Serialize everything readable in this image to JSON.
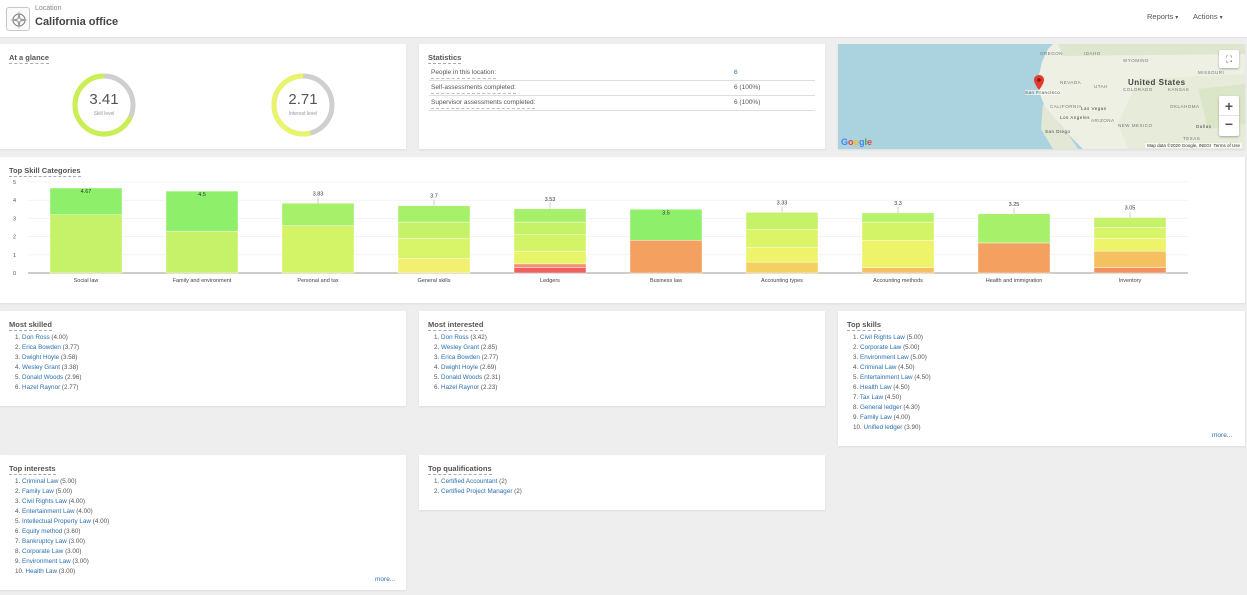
{
  "header": {
    "location_label": "Location",
    "location_name": "California office",
    "reports_label": "Reports",
    "actions_label": "Actions"
  },
  "at_a_glance": {
    "title": "At a glance",
    "gauges": [
      {
        "value": "3.41",
        "label": "Skill level",
        "fraction": 0.68,
        "color": "#c9ef54"
      },
      {
        "value": "2.71",
        "label": "Interest level",
        "fraction": 0.54,
        "color": "#e9f46a"
      }
    ]
  },
  "statistics": {
    "title": "Statistics",
    "rows": [
      {
        "label": "People in this location:",
        "value": "6"
      },
      {
        "label": "Self-assessments completed:",
        "value": "6 (100%)"
      },
      {
        "label": "Supervisor assessments completed:",
        "value": "6 (100%)"
      }
    ]
  },
  "map": {
    "labels": [
      "OREGON",
      "IDAHO",
      "WYOMING",
      "NEVADA",
      "UTAH",
      "COLORADO",
      "KANSAS",
      "CALIFORNIA",
      "ARIZONA",
      "NEW MEXICO",
      "OKLAHOMA",
      "TEXAS",
      "Las Vegas",
      "Los Angeles",
      "San Diego",
      "Dallas",
      "MISSOURI",
      "San Francisco"
    ],
    "country": "United States",
    "attribution": "Map data ©2020 Google, INEGI",
    "terms": "Terms of Use",
    "logo": "Google",
    "zoom_in": "+",
    "zoom_out": "−"
  },
  "top_skill_categories": {
    "title": "Top Skill Categories"
  },
  "chart_data": {
    "type": "bar",
    "stacked": true,
    "ylim": [
      0,
      5
    ],
    "yticks": [
      0,
      1,
      2,
      3,
      4,
      5
    ],
    "categories": [
      "Social law",
      "Family and environment",
      "Personal and tax",
      "General skills",
      "Ledgers",
      "Business law",
      "Accounting types",
      "Accounting methods",
      "Health and immigration",
      "Inventory"
    ],
    "totals": [
      4.67,
      4.5,
      3.83,
      3.7,
      3.53,
      3.5,
      3.33,
      3.3,
      3.25,
      3.05
    ],
    "total_labels": [
      "4.67",
      "4.5",
      "3.83",
      "3.7",
      "3.53",
      "3.5",
      "3.33",
      "3.3",
      "3.25",
      "3.05"
    ],
    "segments": [
      [
        {
          "v": 3.2,
          "c": "#c6f26a"
        },
        {
          "v": 1.47,
          "c": "#8ef06a"
        }
      ],
      [
        {
          "v": 2.3,
          "c": "#c6f26a"
        },
        {
          "v": 2.2,
          "c": "#8ef06a"
        }
      ],
      [
        {
          "v": 2.6,
          "c": "#d4f468"
        },
        {
          "v": 1.23,
          "c": "#a6f06a"
        }
      ],
      [
        {
          "v": 0.8,
          "c": "#f2f070"
        },
        {
          "v": 1.1,
          "c": "#d8f468"
        },
        {
          "v": 0.9,
          "c": "#c6f26a"
        },
        {
          "v": 0.9,
          "c": "#a6f06a"
        }
      ],
      [
        {
          "v": 0.3,
          "c": "#f06060"
        },
        {
          "v": 0.2,
          "c": "#f49070"
        },
        {
          "v": 0.7,
          "c": "#e8f46a"
        },
        {
          "v": 0.9,
          "c": "#d4f468"
        },
        {
          "v": 0.7,
          "c": "#c6f26a"
        },
        {
          "v": 0.73,
          "c": "#a6f06a"
        }
      ],
      [
        {
          "v": 1.8,
          "c": "#f4a060"
        },
        {
          "v": 1.7,
          "c": "#8ef06a"
        }
      ],
      [
        {
          "v": 0.6,
          "c": "#f4d060"
        },
        {
          "v": 0.8,
          "c": "#eef46a"
        },
        {
          "v": 1.0,
          "c": "#dcf468"
        },
        {
          "v": 0.93,
          "c": "#c6f26a"
        }
      ],
      [
        {
          "v": 0.3,
          "c": "#f4c060"
        },
        {
          "v": 1.5,
          "c": "#eef46a"
        },
        {
          "v": 1.0,
          "c": "#d4f468"
        },
        {
          "v": 0.5,
          "c": "#b6f26a"
        }
      ],
      [
        {
          "v": 1.65,
          "c": "#f4a060"
        },
        {
          "v": 1.6,
          "c": "#a6f06a"
        }
      ],
      [
        {
          "v": 0.3,
          "c": "#f49060"
        },
        {
          "v": 0.9,
          "c": "#f4c060"
        },
        {
          "v": 0.7,
          "c": "#eef46a"
        },
        {
          "v": 0.6,
          "c": "#d8f468"
        },
        {
          "v": 0.55,
          "c": "#c6f26a"
        }
      ]
    ]
  },
  "most_skilled": {
    "title": "Most skilled",
    "items": [
      {
        "num": "1.",
        "name": "Don Ross",
        "score": "(4.00)"
      },
      {
        "num": "2.",
        "name": "Erica Bowden",
        "score": "(3.77)"
      },
      {
        "num": "3.",
        "name": "Dwight Hoyle",
        "score": "(3.58)"
      },
      {
        "num": "4.",
        "name": "Wesley Grant",
        "score": "(3.38)"
      },
      {
        "num": "5.",
        "name": "Donald Woods",
        "score": "(2.96)"
      },
      {
        "num": "6.",
        "name": "Hazel Raynor",
        "score": "(2.77)"
      }
    ]
  },
  "most_interested": {
    "title": "Most interested",
    "items": [
      {
        "num": "1.",
        "name": "Don Ross",
        "score": "(3.42)"
      },
      {
        "num": "2.",
        "name": "Wesley Grant",
        "score": "(2.85)"
      },
      {
        "num": "3.",
        "name": "Erica Bowden",
        "score": "(2.77)"
      },
      {
        "num": "4.",
        "name": "Dwight Hoyle",
        "score": "(2.69)"
      },
      {
        "num": "5.",
        "name": "Donald Woods",
        "score": "(2.31)"
      },
      {
        "num": "6.",
        "name": "Hazel Raynor",
        "score": "(2.23)"
      }
    ]
  },
  "top_skills": {
    "title": "Top skills",
    "more": "more...",
    "items": [
      {
        "num": "1.",
        "name": "Civil Rights Law",
        "score": "(5.00)"
      },
      {
        "num": "2.",
        "name": "Corporate Law",
        "score": "(5.00)"
      },
      {
        "num": "3.",
        "name": "Environment Law",
        "score": "(5.00)"
      },
      {
        "num": "4.",
        "name": "Criminal Law",
        "score": "(4.50)"
      },
      {
        "num": "5.",
        "name": "Entertainment Law",
        "score": "(4.50)"
      },
      {
        "num": "6.",
        "name": "Health Law",
        "score": "(4.50)"
      },
      {
        "num": "7.",
        "name": "Tax Law",
        "score": "(4.50)"
      },
      {
        "num": "8.",
        "name": "General ledger",
        "score": "(4.30)"
      },
      {
        "num": "9.",
        "name": "Family Law",
        "score": "(4.00)"
      },
      {
        "num": "10.",
        "name": "Unified ledger",
        "score": "(3.90)"
      }
    ]
  },
  "top_interests": {
    "title": "Top interests",
    "more": "more...",
    "items": [
      {
        "num": "1.",
        "name": "Criminal Law",
        "score": "(5.00)"
      },
      {
        "num": "2.",
        "name": "Family Law",
        "score": "(5.00)"
      },
      {
        "num": "3.",
        "name": "Civil Rights Law",
        "score": "(4.00)"
      },
      {
        "num": "4.",
        "name": "Entertainment Law",
        "score": "(4.00)"
      },
      {
        "num": "5.",
        "name": "Intellectual Property Law",
        "score": "(4.00)"
      },
      {
        "num": "6.",
        "name": "Equity method",
        "score": "(3.60)"
      },
      {
        "num": "7.",
        "name": "Bankruptcy Law",
        "score": "(3.00)"
      },
      {
        "num": "8.",
        "name": "Corporate Law",
        "score": "(3.00)"
      },
      {
        "num": "9.",
        "name": "Environment Law",
        "score": "(3.00)"
      },
      {
        "num": "10.",
        "name": "Health Law",
        "score": "(3.00)"
      }
    ]
  },
  "top_qualifications": {
    "title": "Top qualifications",
    "items": [
      {
        "num": "1.",
        "name": "Certified Accountant",
        "score": "(2)"
      },
      {
        "num": "2.",
        "name": "Certified Project Manager",
        "score": "(2)"
      }
    ]
  }
}
